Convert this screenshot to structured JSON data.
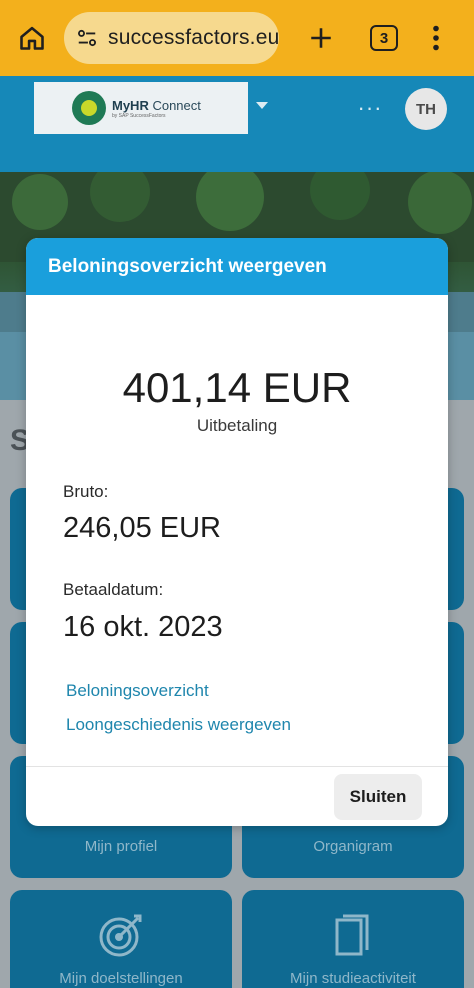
{
  "browser": {
    "url": "successfactors.eu",
    "tab_count": "3"
  },
  "app": {
    "logo_title_bold": "MyHR",
    "logo_title_rest": " Connect",
    "logo_subtitle": "by SAP SuccessFactors",
    "more_label": "···",
    "avatar_initials": "TH"
  },
  "background": {
    "heading": "S",
    "tiles": [
      {
        "label": "Mijn profiel"
      },
      {
        "label": "Organigram"
      },
      {
        "label": "Mijn doelstellingen"
      },
      {
        "label": "Mijn studieactiviteit"
      }
    ]
  },
  "dialog": {
    "title": "Beloningsoverzicht weergeven",
    "amount": "401,14 EUR",
    "amount_label": "Uitbetaling",
    "gross_label": "Bruto:",
    "gross_value": "246,05 EUR",
    "date_label": "Betaaldatum:",
    "date_value": "16 okt. 2023",
    "links": [
      {
        "label": "Beloningsoverzicht"
      },
      {
        "label": "Loongeschiedenis weergeven"
      }
    ],
    "close_label": "Sluiten"
  },
  "colors": {
    "browser_bar": "#f3b01c",
    "app_blue": "#1688b8",
    "dialog_header": "#1a9fdc",
    "link": "#1f86ad"
  }
}
